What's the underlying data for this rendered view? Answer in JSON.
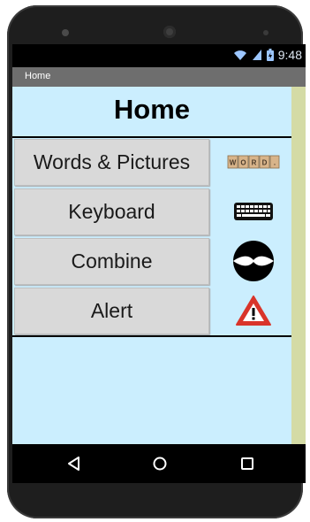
{
  "status_bar": {
    "time": "9:48",
    "icons": [
      "wifi-icon",
      "signal-icon",
      "battery-icon"
    ]
  },
  "app_bar": {
    "title": "Home"
  },
  "main": {
    "heading": "Home",
    "menu": [
      {
        "label": "Words & Pictures",
        "icon": "word-tiles-icon"
      },
      {
        "label": "Keyboard",
        "icon": "keyboard-icon"
      },
      {
        "label": "Combine",
        "icon": "combine-icon"
      },
      {
        "label": "Alert",
        "icon": "warning-icon"
      }
    ],
    "word_tiles": [
      "W",
      "O",
      "R",
      "D",
      "."
    ]
  },
  "nav_bar": {
    "buttons": [
      "back-icon",
      "home-icon",
      "recents-icon"
    ]
  },
  "colors": {
    "screen_bg": "#cbeefe",
    "button_bg": "#d9d9d9",
    "title_bar": "#6e6e6e",
    "right_strip": "#d4dba5",
    "alert_red": "#d9342a"
  }
}
